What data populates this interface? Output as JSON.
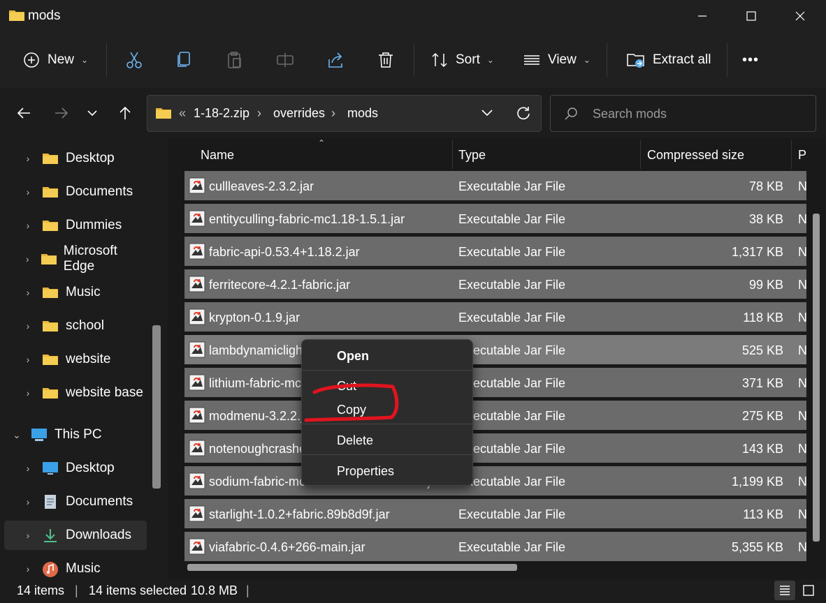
{
  "window": {
    "title": "mods"
  },
  "toolbar": {
    "new_label": "New",
    "sort_label": "Sort",
    "view_label": "View",
    "extract_label": "Extract all",
    "more_label": "•••"
  },
  "address": {
    "overflow": "«",
    "crumbs": [
      "1-18-2.zip",
      "overrides",
      "mods"
    ],
    "search_placeholder": "Search mods"
  },
  "nav": {
    "items": [
      {
        "label": "Desktop",
        "icon": "folder-icon"
      },
      {
        "label": "Documents",
        "icon": "folder-icon"
      },
      {
        "label": "Dummies",
        "icon": "folder-icon"
      },
      {
        "label": "Microsoft Edge",
        "icon": "folder-icon"
      },
      {
        "label": "Music",
        "icon": "folder-icon"
      },
      {
        "label": "school",
        "icon": "folder-icon"
      },
      {
        "label": "website",
        "icon": "folder-icon"
      },
      {
        "label": "website base",
        "icon": "folder-icon"
      }
    ],
    "this_pc": "This PC",
    "pc_items": [
      {
        "label": "Desktop",
        "icon": "desktop-icon"
      },
      {
        "label": "Documents",
        "icon": "documents-icon"
      },
      {
        "label": "Downloads",
        "icon": "downloads-icon"
      },
      {
        "label": "Music",
        "icon": "music-icon"
      }
    ]
  },
  "columns": {
    "name": "Name",
    "type": "Type",
    "compressed": "Compressed size",
    "packed": "Pa"
  },
  "files": [
    {
      "name": "cullleaves-2.3.2.jar",
      "type": "Executable Jar File",
      "size": "78 KB",
      "p": "N"
    },
    {
      "name": "entityculling-fabric-mc1.18-1.5.1.jar",
      "type": "Executable Jar File",
      "size": "38 KB",
      "p": "N"
    },
    {
      "name": "fabric-api-0.53.4+1.18.2.jar",
      "type": "Executable Jar File",
      "size": "1,317 KB",
      "p": "N"
    },
    {
      "name": "ferritecore-4.2.1-fabric.jar",
      "type": "Executable Jar File",
      "size": "99 KB",
      "p": "N"
    },
    {
      "name": "krypton-0.1.9.jar",
      "type": "Executable Jar File",
      "size": "118 KB",
      "p": "N"
    },
    {
      "name": "lambdynamiclights-2.1.0+1.18.2.jar",
      "type": "Executable Jar File",
      "size": "525 KB",
      "p": "N"
    },
    {
      "name": "lithium-fabric-mc1.18.2-0.7.10.jar",
      "type": "Executable Jar File",
      "size": "371 KB",
      "p": "N"
    },
    {
      "name": "modmenu-3.2.2.jar",
      "type": "Executable Jar File",
      "size": "275 KB",
      "p": "N"
    },
    {
      "name": "notenoughcrashes-4.1.4+1.18.2-fabric.jar",
      "type": "Executable Jar File",
      "size": "143 KB",
      "p": "N"
    },
    {
      "name": "sodium-fabric-mc1.18.2-0.4.1+build.15.jar",
      "type": "Executable Jar File",
      "size": "1,199 KB",
      "p": "N"
    },
    {
      "name": "starlight-1.0.2+fabric.89b8d9f.jar",
      "type": "Executable Jar File",
      "size": "113 KB",
      "p": "N"
    },
    {
      "name": "viafabric-0.4.6+266-main.jar",
      "type": "Executable Jar File",
      "size": "5,355 KB",
      "p": "N"
    }
  ],
  "context_menu": {
    "open": "Open",
    "cut": "Cut",
    "copy": "Copy",
    "delete": "Delete",
    "properties": "Properties"
  },
  "status": {
    "count": "14 items",
    "selected": "14 items selected",
    "size": "10.8 MB"
  },
  "colors": {
    "annotation": "#e0141e",
    "folder": "#f2c744",
    "row_selected": "#6b6b6b"
  }
}
